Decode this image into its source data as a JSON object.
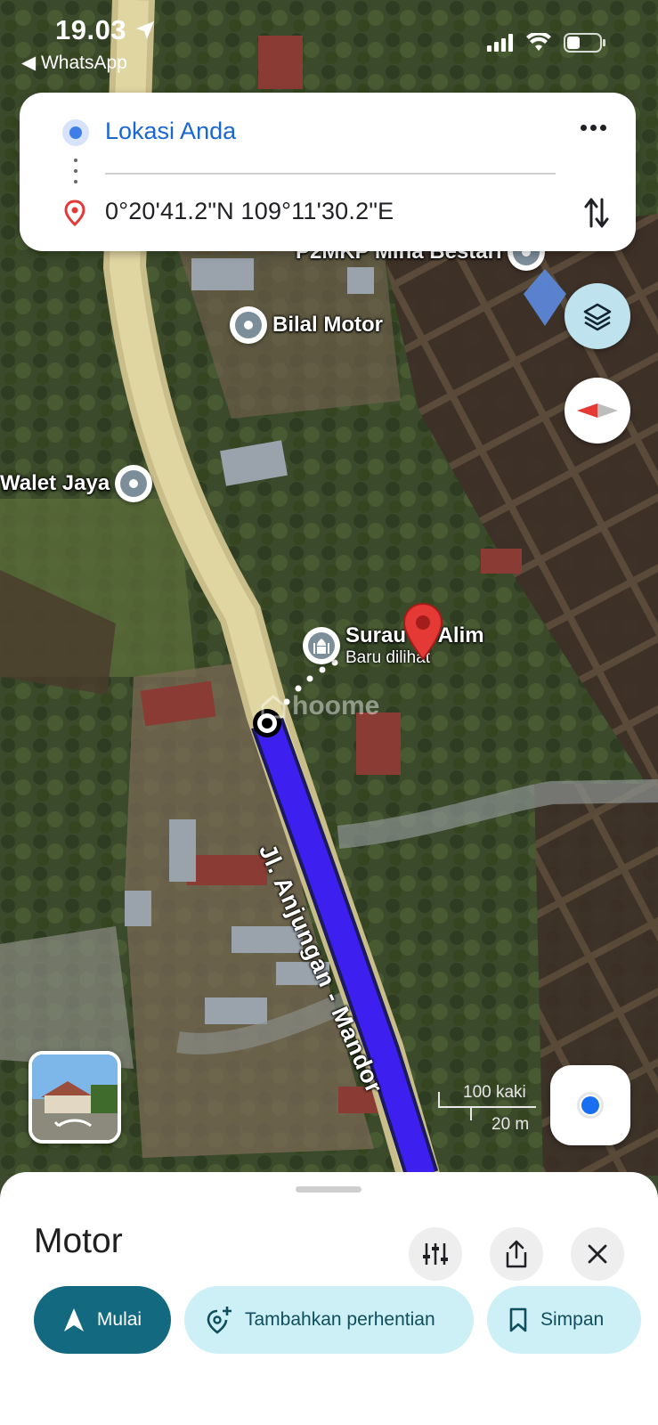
{
  "status_bar": {
    "time": "19.03",
    "back_app": "◀ WhatsApp"
  },
  "directions": {
    "origin": "Lokasi Anda",
    "destination": "0°20'41.2\"N 109°11'30.2\"E"
  },
  "map": {
    "pois": [
      {
        "label": "Bilal Motor"
      },
      {
        "label": "Walet Jaya"
      },
      {
        "label": "P2MKP Mina Bestari"
      },
      {
        "label": "Surau Al Alim",
        "sub": "Baru dilihat"
      }
    ],
    "road_label": "Jl. Anjungan - Mandor",
    "scale_imperial": "100 kaki",
    "scale_metric": "20 m",
    "watermark": "hoome",
    "route_color": "#3d1ff0"
  },
  "sheet": {
    "mode": "Motor",
    "start_label": "Mulai",
    "add_stop_label": "Tambahkan perhentian",
    "save_label": "Simpan"
  },
  "colors": {
    "accent_blue": "#1a66d2",
    "primary_button": "#136a80",
    "chip_bg": "#cdeff6",
    "destination_pin": "#e53935"
  }
}
